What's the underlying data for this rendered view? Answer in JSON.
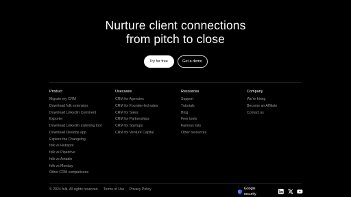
{
  "hero": {
    "title_line1": "Nurture client connections",
    "title_line2": "from pitch to close",
    "primary_cta": "Try for free",
    "secondary_cta": "Get a demo"
  },
  "footer": {
    "columns": [
      {
        "heading": "Product",
        "links": [
          "Migrate my CRM",
          "Download folk extension",
          "Download LinkedIn Comment",
          "Exporter",
          "Download LinkedIn Listening tool",
          "Download Desktop app",
          "Explore the Changelog",
          "folk vs Hubspot",
          "folk vs Pipedrive",
          "folk vs Airtable",
          "folk vs Monday",
          "Other CRM comparisons"
        ]
      },
      {
        "heading": "Usecases",
        "links": [
          "CRM for Agencies",
          "CRM for Founder-led sales",
          "CRM for Sales",
          "CRM for Partnerships",
          "CRM for Startups",
          "CRM for Venture Capital"
        ]
      },
      {
        "heading": "Resources",
        "links": [
          "Support",
          "Tutorials",
          "Blog",
          "Free tools",
          "Famous lists",
          "Other resources"
        ]
      },
      {
        "heading": "Company",
        "links": [
          "We're hiring",
          "Become an Affiliate",
          "Contact us"
        ]
      }
    ],
    "copyright": "© 2024 folk. All rights reserved.",
    "terms": "Terms of Use",
    "privacy": "Privacy Policy",
    "security": "Google security",
    "icons": [
      "shield-icon",
      "linkedin-icon",
      "x-icon",
      "youtube-icon"
    ]
  }
}
